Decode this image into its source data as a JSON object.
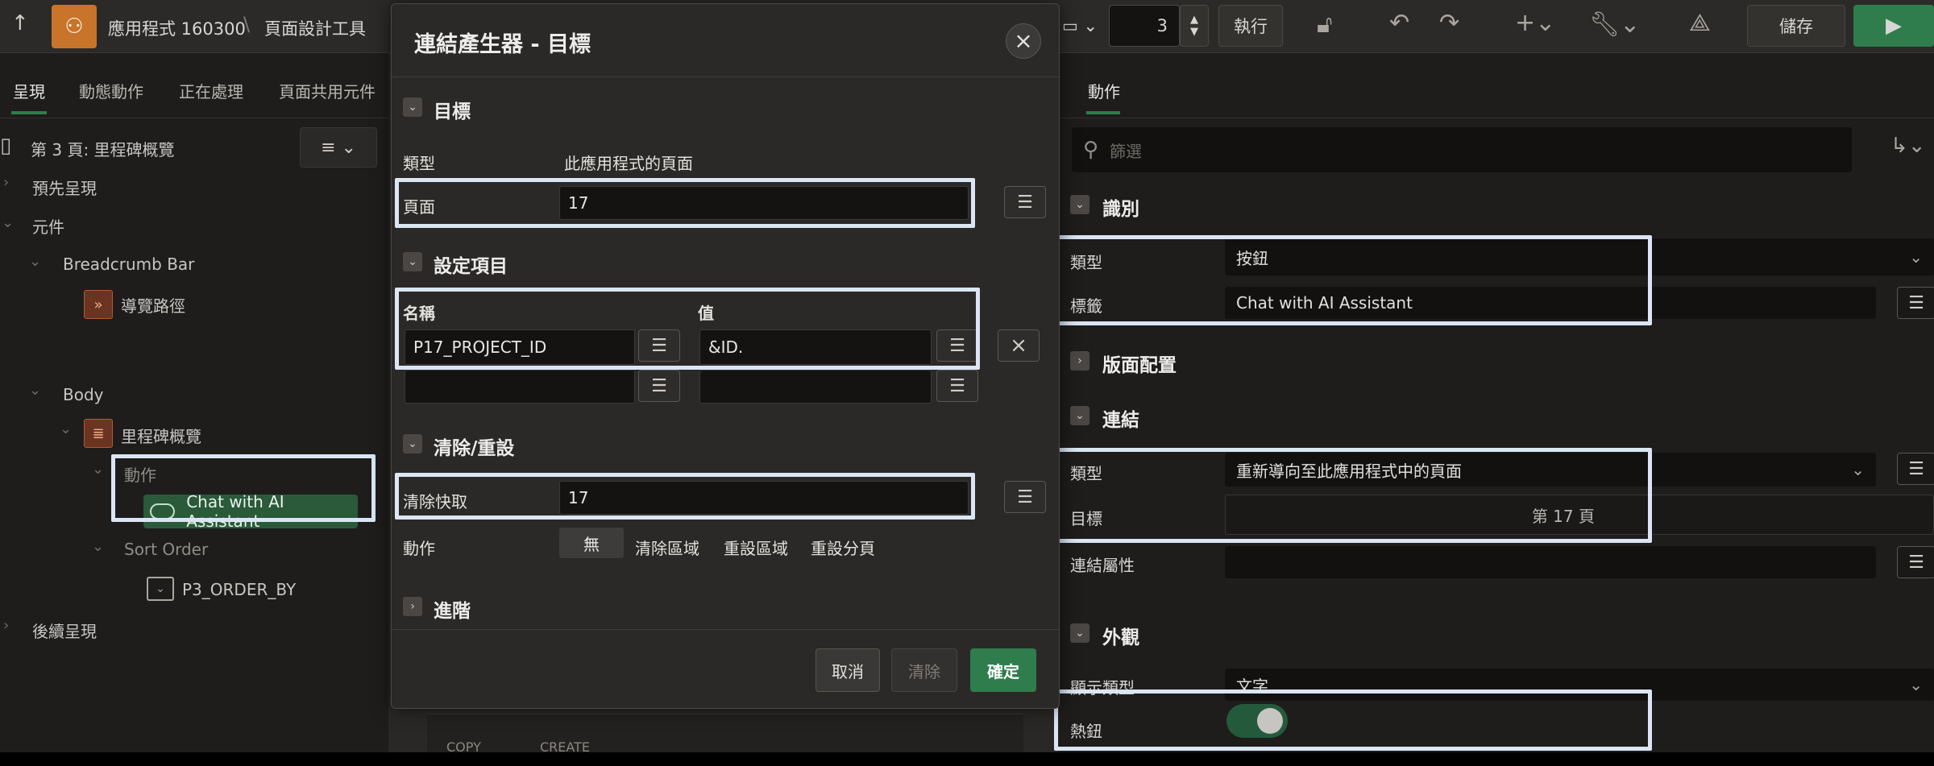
{
  "topbar": {
    "app_name": "應用程式 160300",
    "separator": "\\",
    "tool_name": "頁面設計工具",
    "page_number": "3",
    "run_label": "執行",
    "save_label": "儲存"
  },
  "left": {
    "tabs": [
      "呈現",
      "動態動作",
      "正在處理",
      "頁面共用元件"
    ],
    "page_title": "第 3 頁: 里程碑概覽",
    "tree": {
      "pre_render": "預先呈現",
      "components": "元件",
      "breadcrumb_bar": "Breadcrumb Bar",
      "breadcrumb": "導覽路徑",
      "body": "Body",
      "region": "里程碑概覽",
      "actions": "動作",
      "button": "Chat with AI Assistant",
      "sort_order": "Sort Order",
      "order_by": "P3_ORDER_BY",
      "post_render": "後續呈現"
    },
    "bottom_buttons": [
      "COPY",
      "CREATE"
    ]
  },
  "dialog": {
    "title": "連結產生器 - 目標",
    "target": {
      "heading": "目標",
      "type_label": "類型",
      "type_value": "此應用程式的頁面",
      "page_label": "頁面",
      "page_value": "17"
    },
    "set_items": {
      "heading": "設定項目",
      "name_header": "名稱",
      "value_header": "值",
      "rows": [
        {
          "name": "P17_PROJECT_ID",
          "value": "&ID."
        },
        {
          "name": "",
          "value": ""
        }
      ]
    },
    "clear": {
      "heading": "清除/重設",
      "clear_cache_label": "清除快取",
      "clear_cache_value": "17",
      "action_label": "動作",
      "options": [
        "無",
        "清除區域",
        "重設區域",
        "重設分頁"
      ]
    },
    "advanced_heading": "進階",
    "cancel_label": "取消",
    "clear_label": "清除",
    "ok_label": "確定"
  },
  "right": {
    "tab": "動作",
    "filter_placeholder": "篩選",
    "identification": {
      "heading": "識別",
      "type_label": "類型",
      "type_value": "按鈕",
      "label_label": "標籤",
      "label_value": "Chat with AI Assistant"
    },
    "layout_heading": "版面配置",
    "link": {
      "heading": "連結",
      "type_label": "類型",
      "type_value": "重新導向至此應用程式中的頁面",
      "target_label": "目標",
      "target_value": "第 17 頁",
      "attributes_label": "連結屬性"
    },
    "appearance": {
      "heading": "外觀",
      "display_type_label": "顯示類型",
      "display_type_value": "文字",
      "hot_label": "熱鈕",
      "hot_on": true
    }
  },
  "colors": {
    "accent_green": "#2f7d4c",
    "highlight_border": "#dbe6f4",
    "app_icon": "#c8742a"
  }
}
